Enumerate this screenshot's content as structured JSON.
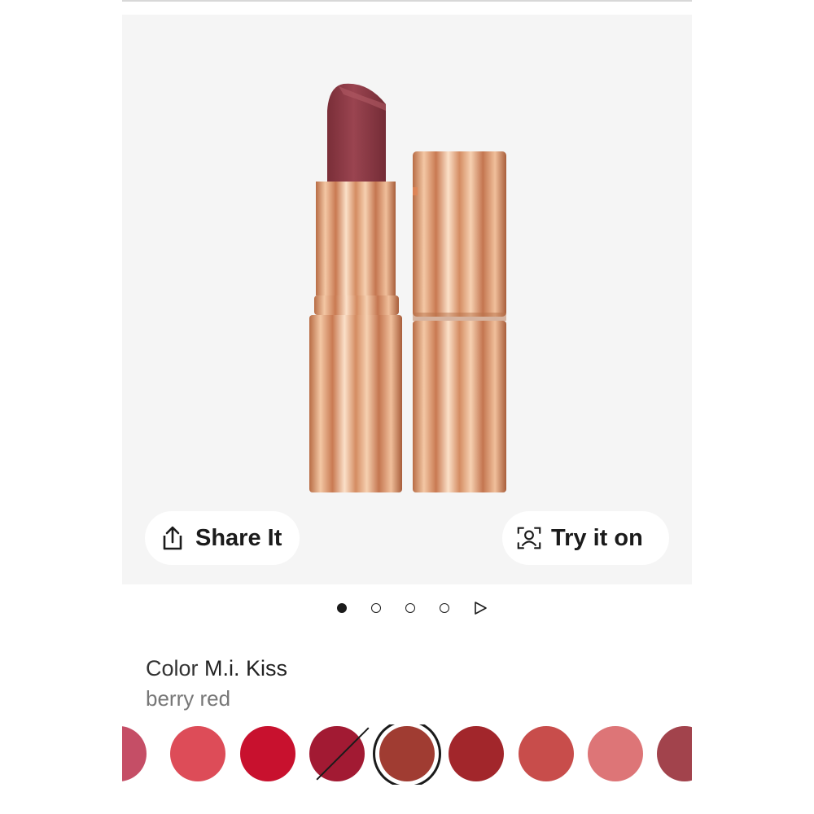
{
  "gallery": {
    "share_label": "Share It",
    "try_label": "Try it on",
    "share_icon": "share-icon",
    "try_icon": "face-scan-icon"
  },
  "pager": {
    "count": 4,
    "active_index": 0,
    "play_icon": "play-icon"
  },
  "shade": {
    "prefix": "Color",
    "name": "M.i. Kiss",
    "description": "berry red"
  },
  "swatches": [
    {
      "color": "#c54e66",
      "selected": false,
      "unavailable": false
    },
    {
      "color": "#dd4c58",
      "selected": false,
      "unavailable": false
    },
    {
      "color": "#c8112e",
      "selected": false,
      "unavailable": false
    },
    {
      "color": "#a21a33",
      "selected": false,
      "unavailable": true
    },
    {
      "color": "#a03c32",
      "selected": true,
      "unavailable": false
    },
    {
      "color": "#a2262b",
      "selected": false,
      "unavailable": false
    },
    {
      "color": "#c84d4b",
      "selected": false,
      "unavailable": false
    },
    {
      "color": "#dd7577",
      "selected": false,
      "unavailable": false
    },
    {
      "color": "#a2434c",
      "selected": false,
      "unavailable": false
    }
  ],
  "colors": {
    "lipstick": "#8e3a44",
    "gold": "#e0a27a",
    "gallery_bg": "#f5f5f5"
  }
}
